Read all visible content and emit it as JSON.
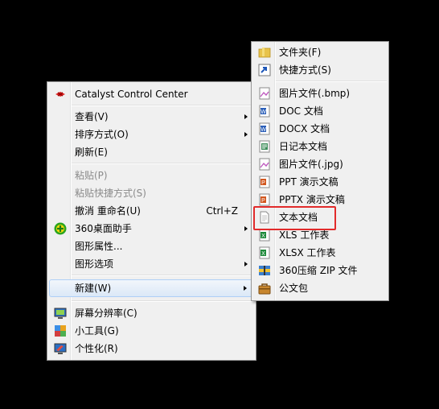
{
  "context_menu": {
    "items": [
      {
        "label": "Catalyst Control Center"
      },
      {
        "label": "查看(V)"
      },
      {
        "label": "排序方式(O)"
      },
      {
        "label": "刷新(E)"
      },
      {
        "label": "粘贴(P)"
      },
      {
        "label": "粘贴快捷方式(S)"
      },
      {
        "label": "撤消 重命名(U)",
        "shortcut": "Ctrl+Z"
      },
      {
        "label": "360桌面助手"
      },
      {
        "label": "图形属性..."
      },
      {
        "label": "图形选项"
      },
      {
        "label": "新建(W)"
      },
      {
        "label": "屏幕分辨率(C)"
      },
      {
        "label": "小工具(G)"
      },
      {
        "label": "个性化(R)"
      }
    ]
  },
  "new_submenu": {
    "items": [
      {
        "label": "文件夹(F)"
      },
      {
        "label": "快捷方式(S)"
      },
      {
        "label": "图片文件(.bmp)"
      },
      {
        "label": "DOC 文档"
      },
      {
        "label": "DOCX 文档"
      },
      {
        "label": "日记本文档"
      },
      {
        "label": "图片文件(.jpg)"
      },
      {
        "label": "PPT 演示文稿"
      },
      {
        "label": "PPTX 演示文稿"
      },
      {
        "label": "文本文档"
      },
      {
        "label": "XLS 工作表"
      },
      {
        "label": "XLSX 工作表"
      },
      {
        "label": "360压缩 ZIP 文件"
      },
      {
        "label": "公文包"
      }
    ]
  },
  "colors": {
    "annotation_box": "#e22b2b",
    "menu_background": "#f0f0f0",
    "disabled_text": "#8a8a8a"
  }
}
